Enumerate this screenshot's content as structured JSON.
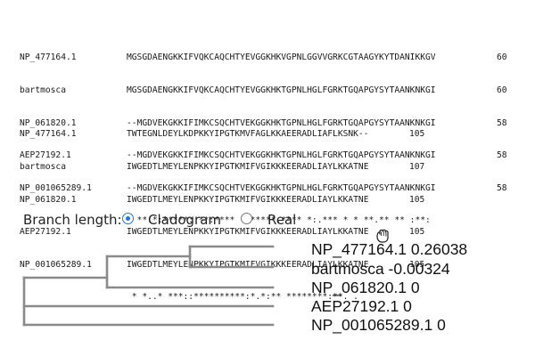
{
  "alignment": {
    "block1": {
      "rows": [
        {
          "name": "NP_477164.1",
          "seq": "MGSGDAENGKKIFVQKCAQCHTYEVGGKHKVGPNLGGVVGRKCGTAAGYKYTDANIKKGV",
          "pos": "60"
        },
        {
          "name": "bartmosca",
          "seq": "MGSGDAENGKKIFVQKCAQCHTYEVGGKHKTGPNLHGLFGRKTGQAPGYSYTAANKNKGI",
          "pos": "60"
        },
        {
          "name": "NP_061820.1",
          "seq": "--MGDVEKGKKIFIMKCSQCHTVEKGGKHKTGPNLHGLFGRKTGQAPGYSYTAANKNKGI",
          "pos": "58"
        },
        {
          "name": "AEP27192.1",
          "seq": "--MGDVEKGKKIFIMKCSQCHTVEKGGKHKTGPNLHGLFGRKTGQAPGYSYTAANKNKGI",
          "pos": "58"
        },
        {
          "name": "NP_001065289.1",
          "seq": "--MGDVEKGKKIFIMKCSQCHTVEKGGKHKTGPNLHGLFGRKTGQAPGYSYTAANKNKGI",
          "pos": "58"
        }
      ],
      "consensus": "  **.*:*****: **:**** * *****.**** *:.*** * * **.** ** :**:"
    },
    "block2": {
      "rows": [
        {
          "name": "NP_477164.1",
          "seq": "TWTEGNLDEYLKDPKKYIPGTKMVFAGLKKAEERADLIAFLKSNK--",
          "pos": "105"
        },
        {
          "name": "bartmosca",
          "seq": "IWGEDTLMEYLENPKKYIPGTKMIFVGIKKKEERADLIAYLKKATNE",
          "pos": "107"
        },
        {
          "name": "NP_061820.1",
          "seq": "IWGEDTLMEYLENPKKYIPGTKMIFVGIKKKEERADLIAYLKKATNE",
          "pos": "105"
        },
        {
          "name": "AEP27192.1",
          "seq": "IWGEDTLMEYLENPKKYIPGTKMIFVGIKKKEERADLIAYLKKATNE",
          "pos": "105"
        },
        {
          "name": "NP_001065289.1",
          "seq": "IWGEDTLMEYLENPKKYIPGTKMIFVGIKKKEERADLIAYLKKATNE",
          "pos": "105"
        }
      ],
      "consensus": " * *..* ***::**********:*.*:** ********:**. ."
    }
  },
  "branch_length": {
    "label": "Branch length:",
    "options": [
      {
        "label": "Cladogram",
        "checked": true
      },
      {
        "label": "Real",
        "checked": false
      }
    ]
  },
  "tree": {
    "leaves": [
      "NP_477164.1 0.26038",
      "bartmosca -0.00324",
      "NP_061820.1 0",
      "AEP27192.1 0",
      "NP_001065289.1 0"
    ],
    "branch_color": "#8a8a8a"
  },
  "cursor_icon": "grab-hand-icon",
  "accent_color": "#1a73e8"
}
